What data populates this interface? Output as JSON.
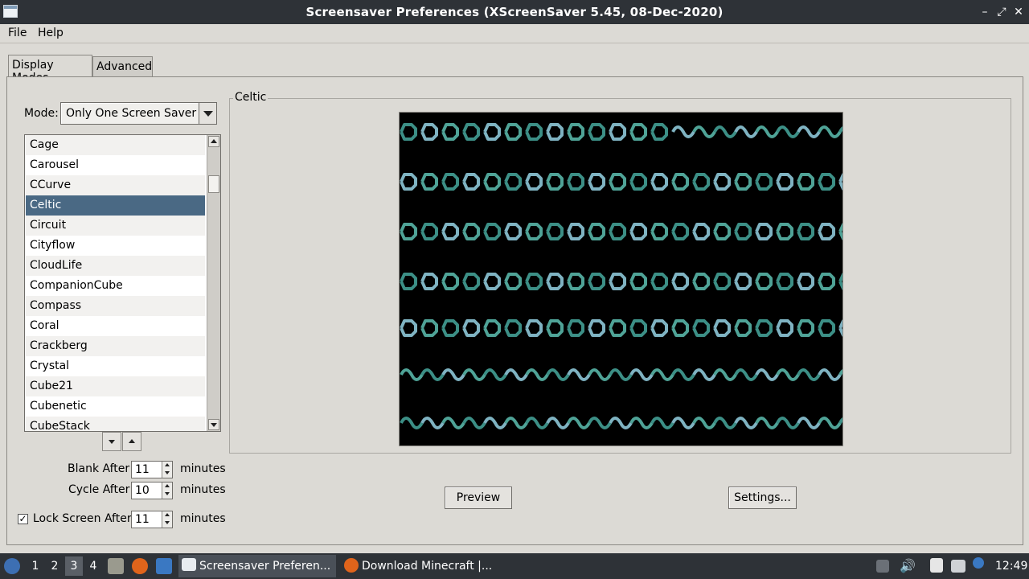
{
  "window": {
    "title": "Screensaver Preferences  (XScreenSaver 5.45, 08-Dec-2020)",
    "controls": [
      "–",
      "⤢",
      "✕"
    ]
  },
  "menu": {
    "file": "File",
    "help": "Help"
  },
  "tabs": [
    "Display Modes",
    "Advanced"
  ],
  "mode": {
    "label": "Mode:",
    "value": "Only One Screen Saver"
  },
  "list": {
    "items": [
      "Cage",
      "Carousel",
      "CCurve",
      "Celtic",
      "Circuit",
      "Cityflow",
      "CloudLife",
      "CompanionCube",
      "Compass",
      "Coral",
      "Crackberg",
      "Crystal",
      "Cube21",
      "Cubenetic",
      "CubeStack"
    ],
    "selected": "Celtic"
  },
  "timing": {
    "blank_label": "Blank After",
    "blank_value": "11",
    "blank_unit": "minutes",
    "cycle_label": "Cycle After",
    "cycle_value": "10",
    "cycle_unit": "minutes",
    "lock_label": "Lock Screen After",
    "lock_value": "11",
    "lock_unit": "minutes",
    "lock_checked": "✓"
  },
  "preview": {
    "frame_title": "Celtic",
    "preview_button": "Preview",
    "settings_button": "Settings..."
  },
  "taskbar": {
    "workspaces": [
      "1",
      "2",
      "3",
      "4"
    ],
    "windows": [
      "Screensaver Preferen...",
      "Download Minecraft |..."
    ],
    "clock": "12:49"
  },
  "colors": {
    "selection": "#4a6984",
    "pattern": [
      "#3c8f86",
      "#7fb3c2",
      "#4fa397"
    ]
  }
}
